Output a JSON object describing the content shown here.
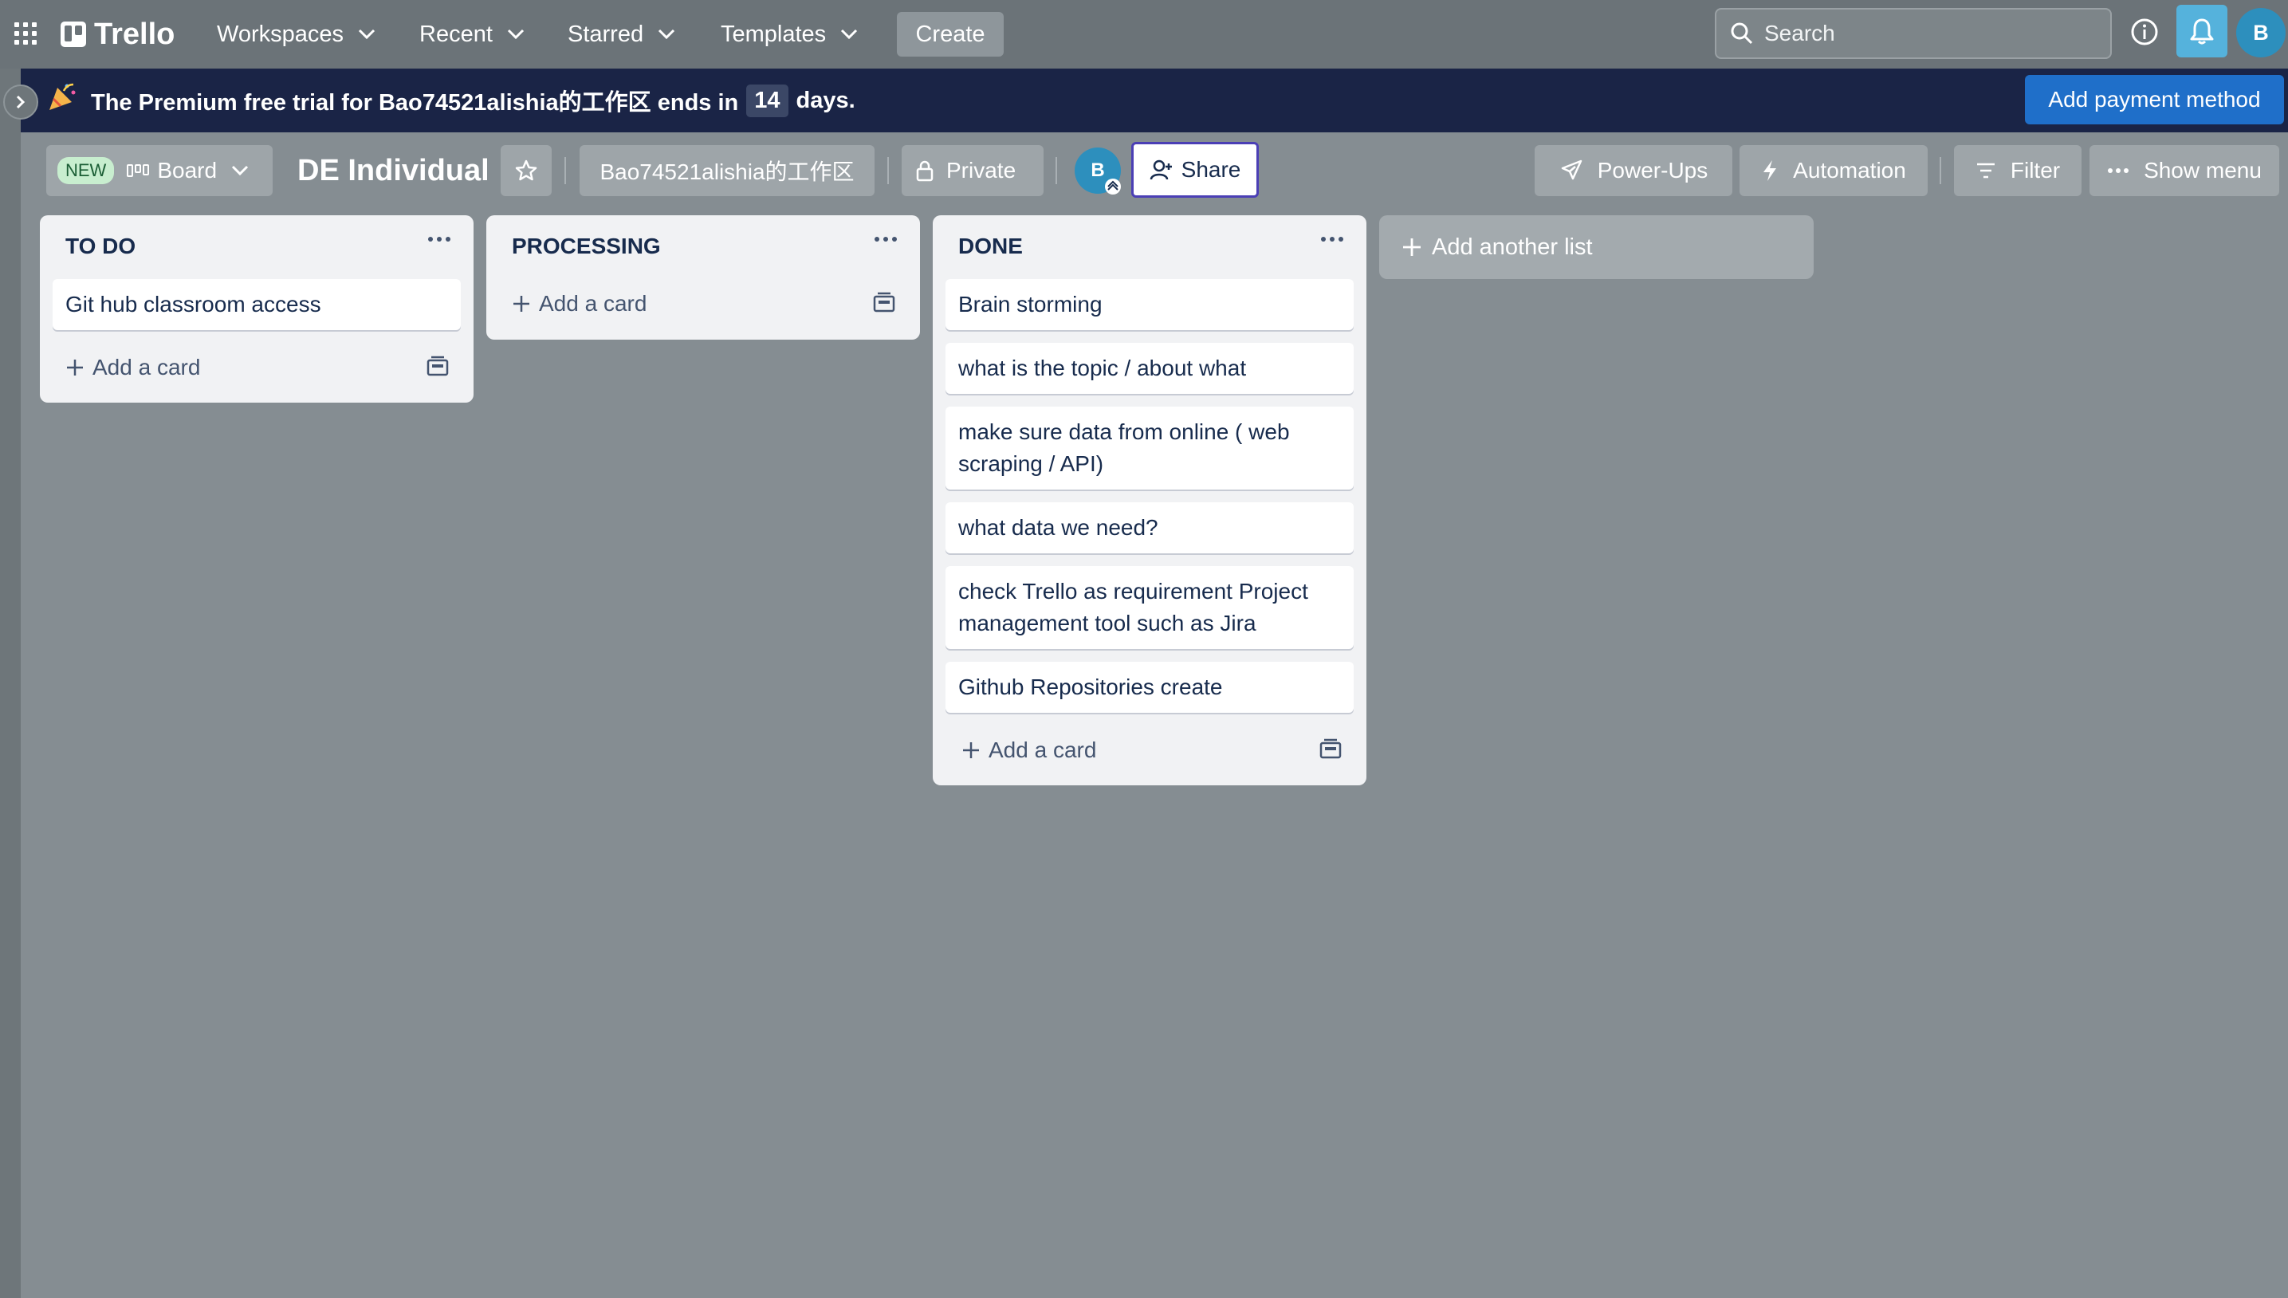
{
  "nav": {
    "logo": "Trello",
    "workspaces": "Workspaces",
    "recent": "Recent",
    "starred": "Starred",
    "templates": "Templates",
    "create": "Create",
    "search_placeholder": "Search",
    "avatar_initial": "B"
  },
  "banner": {
    "text_before": "The Premium free trial for Bao74521alishia的工作区 ends in",
    "days": "14",
    "text_after": "days.",
    "button": "Add payment method"
  },
  "board_header": {
    "new_badge": "NEW",
    "view": "Board",
    "title": "DE Individual",
    "workspace": "Bao74521alishia的工作区",
    "visibility": "Private",
    "member_initial": "B",
    "share": "Share",
    "power_ups": "Power-Ups",
    "automation": "Automation",
    "filter": "Filter",
    "show_menu": "Show menu"
  },
  "lists": [
    {
      "title": "TO DO",
      "cards": [
        "Git hub classroom access"
      ],
      "add_card": "Add a card"
    },
    {
      "title": "PROCESSING",
      "cards": [],
      "add_card": "Add a card"
    },
    {
      "title": "DONE",
      "cards": [
        "Brain storming",
        "what is the topic / about what",
        "make sure data from online ( web scraping / API)",
        "what data we need?",
        "check Trello as requirement Project management tool such as Jira",
        "Github Repositories create"
      ],
      "add_card": "Add a card"
    }
  ],
  "add_list": "Add another list",
  "colors": {
    "banner_bg": "#1a2446",
    "board_bg": "#858d92",
    "accent": "#1f6fc9",
    "share_border": "#4b3fb5"
  }
}
